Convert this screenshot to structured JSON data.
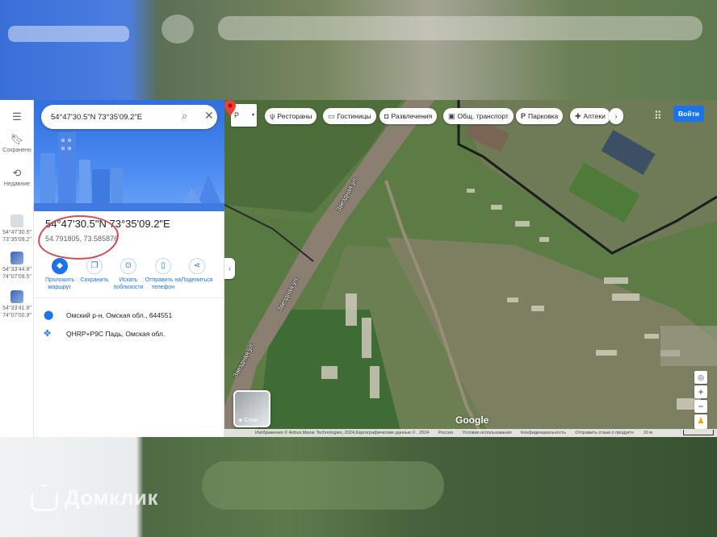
{
  "rail": {
    "menu_icon": "menu-icon",
    "saved": "Сохранено",
    "recent": "Недавние",
    "recents": [
      {
        "line1": "54°47'30.5\"",
        "line2": "73°35'09.2\""
      },
      {
        "line1": "54°33'44.8\"",
        "line2": "74°07'09.5\""
      },
      {
        "line1": "54°33'41.8\"",
        "line2": "74°07'00.9\""
      }
    ]
  },
  "search": {
    "value": "54°47'30.5\"N 73°35'09.2\"E"
  },
  "place": {
    "title": "54°47'30.5\"N 73°35'09.2\"E",
    "decimal": "54.791805, 73.585876"
  },
  "actions": [
    {
      "label": "Проложить маршрут"
    },
    {
      "label": "Сохранить"
    },
    {
      "label": "Искать поблизости"
    },
    {
      "label": "Отправить на телефон"
    },
    {
      "label": "Поделиться"
    }
  ],
  "info": {
    "address": "Омский р-н, Омская обл., 644551",
    "plus_code": "QHRP+P9C Падь, Омская обл."
  },
  "map": {
    "lang": "Р",
    "chips": [
      "Рестораны",
      "Гостиницы",
      "Развлечения",
      "Общ. транспорт",
      "Парковка",
      "Аптеки"
    ],
    "login": "Войти",
    "layers": "Слои",
    "google": "Google",
    "roads": [
      "Звездная ул.",
      "Звездная ул.",
      "Звездная ул."
    ],
    "attribution": {
      "imagery": "Изображения © Airbus,Maxar Technologies, 2024,Картографические данные © , 2024",
      "country": "Россия",
      "terms": "Условия использования",
      "privacy": "Конфиденциальность",
      "feedback": "Отправить отзыв о продукте",
      "scale": "10 м"
    },
    "pin_color": "#ea4335"
  },
  "watermark": "Домклик"
}
